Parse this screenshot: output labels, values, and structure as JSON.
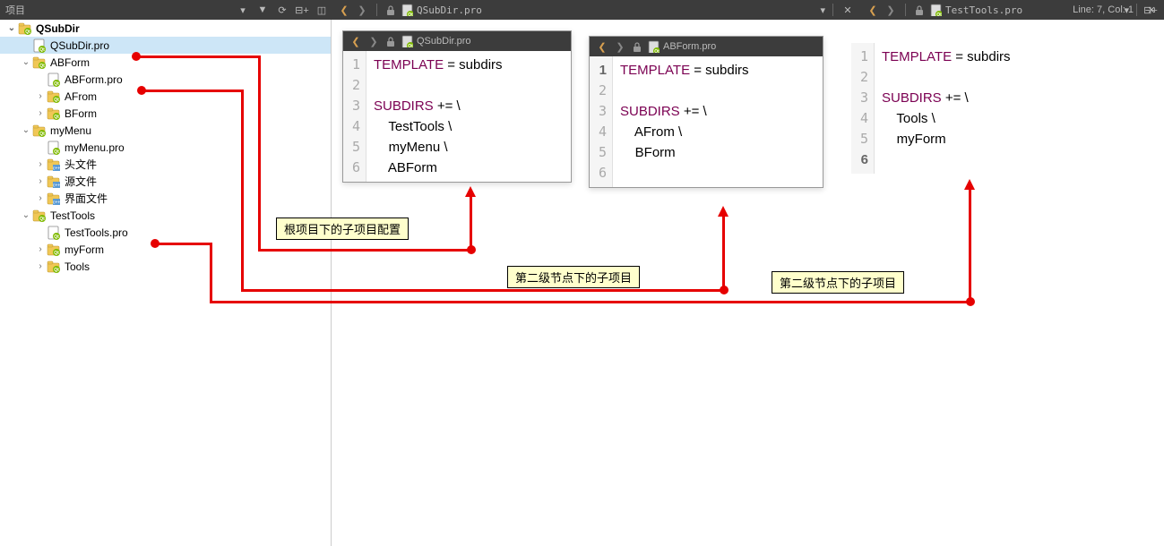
{
  "panel": {
    "title": "项目"
  },
  "status": {
    "pos": "Line: 7, Col: 1"
  },
  "tabs": {
    "main": {
      "file": "QSubDir.pro"
    },
    "right": {
      "file": "TestTools.pro"
    }
  },
  "tree": {
    "root": "QSubDir",
    "rootFile": "QSubDir.pro",
    "n1": {
      "name": "ABForm",
      "file": "ABForm.pro",
      "c1": "AFrom",
      "c2": "BForm"
    },
    "n2": {
      "name": "myMenu",
      "file": "myMenu.pro",
      "c1": "头文件",
      "c2": "源文件",
      "c3": "界面文件"
    },
    "n3": {
      "name": "TestTools",
      "file": "TestTools.pro",
      "c1": "myForm",
      "c2": "Tools"
    }
  },
  "editor1": {
    "tab": "QSubDir.pro",
    "l1a": "TEMPLATE",
    "l1b": " = subdirs",
    "l3a": "SUBDIRS",
    "l3b": " += \\",
    "l4": "    TestTools \\",
    "l5": "    myMenu \\",
    "l6": "    ABForm"
  },
  "editor2": {
    "tab": "ABForm.pro",
    "l1a": "TEMPLATE",
    "l1b": " = subdirs",
    "l3a": "SUBDIRS",
    "l3b": " += \\",
    "l4": "    AFrom \\",
    "l5": "    BForm"
  },
  "editor3": {
    "l1a": "TEMPLATE",
    "l1b": " = subdirs",
    "l3a": "SUBDIRS",
    "l3b": " += \\",
    "l4": "    Tools \\",
    "l5": "    myForm"
  },
  "callout1": "根项目下的子项目配置",
  "callout2": "第二级节点下的子项目",
  "callout3": "第二级节点下的子项目"
}
